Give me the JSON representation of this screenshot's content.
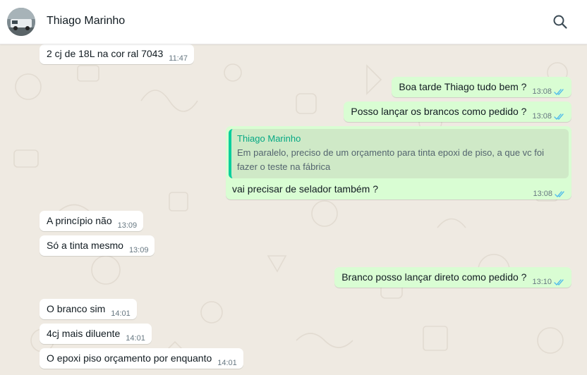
{
  "header": {
    "contact_name": "Thiago Marinho",
    "avatar_icon": "contact-photo",
    "search_icon": "search-icon"
  },
  "colors": {
    "incoming_bubble": "#ffffff",
    "outgoing_bubble": "#d9fdd3",
    "chat_background": "#efeae2",
    "read_ticks": "#53bdeb",
    "quote_accent": "#06cf9c"
  },
  "messages": [
    {
      "direction": "in",
      "text": "2 cj de 18L na cor ral 7043",
      "time": "11:47"
    },
    {
      "direction": "out",
      "text": "Boa tarde Thiago tudo bem ?",
      "time": "13:08",
      "status": "read"
    },
    {
      "direction": "out",
      "text": "Posso lançar os brancos como pedido ?",
      "time": "13:08",
      "status": "read"
    },
    {
      "direction": "out",
      "text": "vai precisar de selador também ?",
      "time": "13:08",
      "status": "read",
      "quote": {
        "author": "Thiago Marinho",
        "text": "Em paralelo, preciso de um orçamento para tinta epoxi de piso, a que vc foi fazer o teste na fábrica"
      }
    },
    {
      "direction": "in",
      "text": "A princípio não",
      "time": "13:09"
    },
    {
      "direction": "in",
      "text": "Só a tinta mesmo",
      "time": "13:09"
    },
    {
      "direction": "out",
      "text": "Branco posso lançar direto como pedido ?",
      "time": "13:10",
      "status": "read"
    },
    {
      "direction": "in",
      "text": "O branco sim",
      "time": "14:01"
    },
    {
      "direction": "in",
      "text": "4cj mais diluente",
      "time": "14:01"
    },
    {
      "direction": "in",
      "text": "O epoxi piso orçamento por enquanto",
      "time": "14:01"
    }
  ]
}
